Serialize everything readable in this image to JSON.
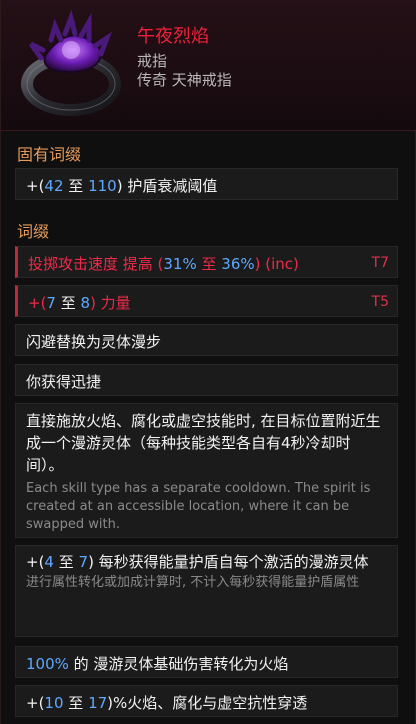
{
  "header": {
    "name": "午夜烈焰",
    "type": "戒指",
    "rarity": "传奇 天神戒指",
    "icon": "ring-icon"
  },
  "sections": {
    "implicit_title": "固有词缀",
    "affix_title": "词缀"
  },
  "implicit": {
    "prefix": "+(",
    "min": "42",
    "to": " 至 ",
    "max": "110",
    "suffix": ") 护盾衰减阈值"
  },
  "affixes": {
    "a1": {
      "label": "投掷攻击速度 提高 (",
      "min": "31%",
      "to": " 至 ",
      "max": "36%",
      "suffix": ") (inc)",
      "tier": "T7"
    },
    "a2": {
      "prefix": "+(",
      "min": "7",
      "to": " 至 ",
      "max": "8",
      "suffix": ") 力量",
      "tier": "T5"
    }
  },
  "unique": {
    "line1": "闪避替换为灵体漫步",
    "line2": "你获得迅捷",
    "line3": "直接施放火焰、腐化或虚空技能时, 在目标位置附近生成一个漫游灵体（每种技能类型各自有4秒冷却时间）。",
    "line3_note": "Each skill type has a separate cooldown. The spirit is created at an accessible location, where it can be swapped with.",
    "line4_prefix": "+(",
    "line4_min": "4",
    "line4_to": " 至 ",
    "line4_max": "7",
    "line4_suffix": ") 每秒获得能量护盾自每个激活的漫游灵体",
    "line4_note": "进行属性转化或加成计算时, 不计入每秒获得能量护盾属性",
    "line5_value": "100%",
    "line5_text": " 的 漫游灵体基础伤害转化为火焰",
    "line6_prefix": "+(",
    "line6_min": "10",
    "line6_to": " 至 ",
    "line6_max": "17",
    "line6_suffix": ")%火焰、腐化与虚空抗性穿透"
  },
  "colors": {
    "name": "#f0203b",
    "section": "#e59a5b",
    "value_blue": "#5fa8ff",
    "affix_red": "#ef2a48"
  }
}
